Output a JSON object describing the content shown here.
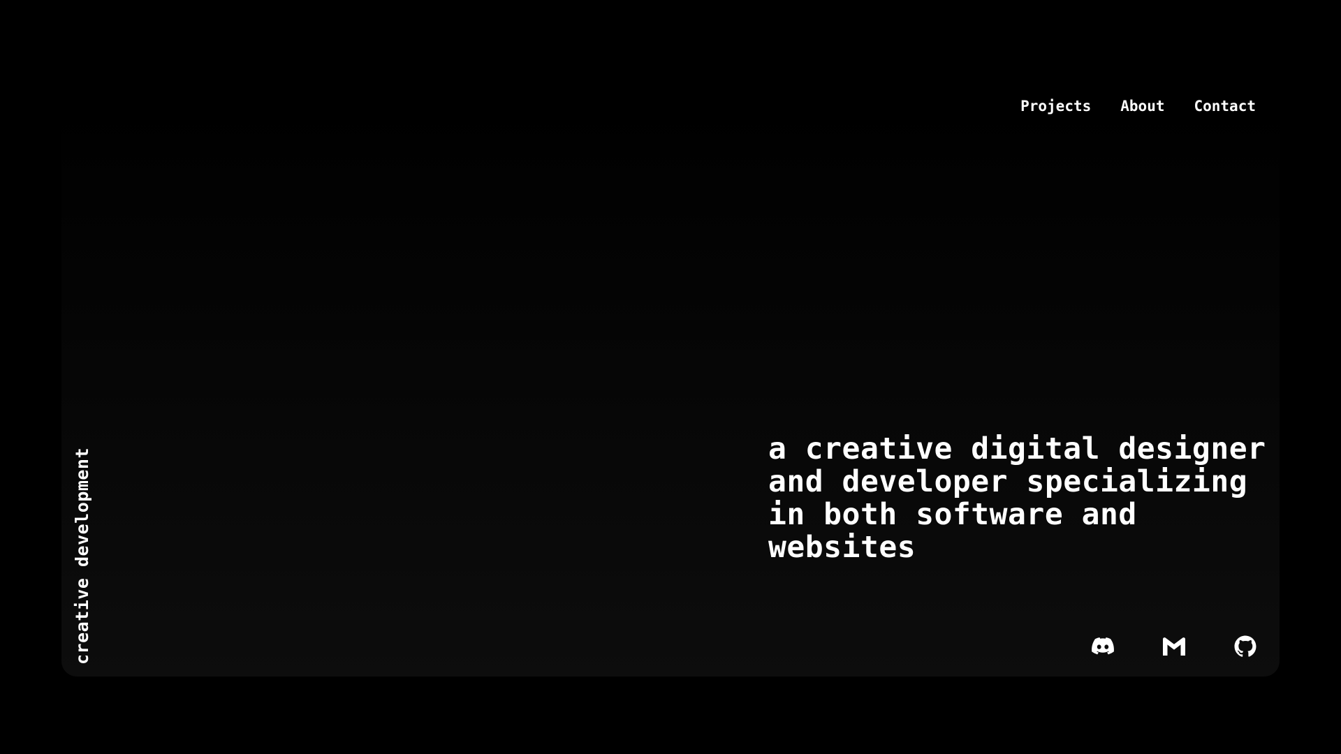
{
  "nav": {
    "items": [
      {
        "label": "Projects"
      },
      {
        "label": "About"
      },
      {
        "label": "Contact"
      }
    ]
  },
  "side_label": "creative development",
  "hero": {
    "lines": [
      "a creative digital designer",
      "and developer specializing",
      "in both software and",
      "websites"
    ]
  },
  "socials": [
    {
      "icon": "discord-icon"
    },
    {
      "icon": "gmail-icon"
    },
    {
      "icon": "github-icon"
    }
  ],
  "colors": {
    "background": "#000000",
    "panel": "#0d0d0d",
    "text": "#ffffff"
  }
}
